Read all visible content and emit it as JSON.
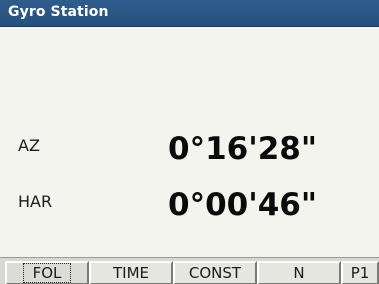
{
  "window": {
    "title": "Gyro Station"
  },
  "readings": {
    "az": {
      "label": "AZ",
      "value": "0°16'28\""
    },
    "har": {
      "label": "HAR",
      "value": "0°00'46\""
    }
  },
  "softkeys": [
    {
      "label": "FOL",
      "selected": true
    },
    {
      "label": "TIME",
      "selected": false
    },
    {
      "label": "CONST",
      "selected": false
    },
    {
      "label": "N",
      "selected": false
    },
    {
      "label": "P1",
      "selected": false
    }
  ],
  "colors": {
    "titlebar": "#2f5d8c",
    "background": "#f4f4ef",
    "softkey_face": "#e6e6e1"
  }
}
